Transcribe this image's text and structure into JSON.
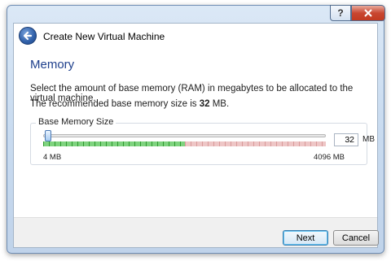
{
  "window": {
    "title": "Create New Virtual Machine",
    "help_label": "?"
  },
  "page": {
    "heading": "Memory",
    "description": "Select the amount of base memory (RAM) in megabytes to be allocated to the virtual machine.",
    "recommended_prefix": "The recommended base memory size is ",
    "recommended_value": "32",
    "recommended_suffix": " MB."
  },
  "memory": {
    "group_title": "Base Memory Size",
    "min_label": "4 MB",
    "max_label": "4096 MB",
    "value": "32",
    "unit": "MB",
    "level_fraction": 0.0068
  },
  "colors": {
    "safe_zone": "#7fd37f",
    "warn_zone": "#eec6c6",
    "heading": "#1e3f8c"
  },
  "buttons": {
    "next": "Next",
    "cancel": "Cancel"
  },
  "icons": {
    "back": "back-arrow-icon",
    "help": "help-icon",
    "close": "close-icon"
  }
}
